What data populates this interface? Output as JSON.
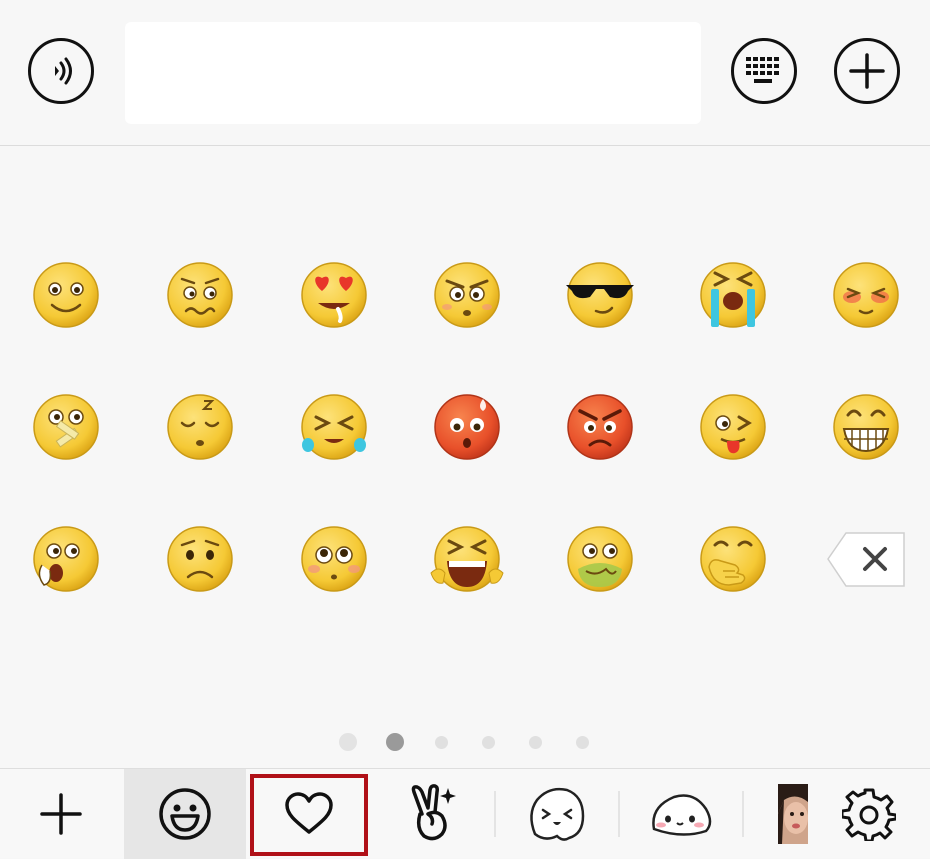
{
  "topbar": {
    "voice_icon": "voice-input-icon",
    "message_input_value": "",
    "keyboard_icon": "keyboard-icon",
    "more_icon": "plus-circle-icon"
  },
  "emoji_panel": {
    "rows": [
      [
        "smile",
        "awkward",
        "heart-eyes",
        "stare",
        "cool",
        "crying-loud",
        "blushing"
      ],
      [
        "shush",
        "sleepy",
        "tears-of-laughter",
        "embarrassed",
        "angry",
        "tongue-wink",
        "grin"
      ],
      [
        "surprised",
        "sad",
        "pleading",
        "scream",
        "nauseous",
        "giggle"
      ]
    ],
    "delete_icon": "backspace-icon",
    "page_count": 6,
    "current_page": 2
  },
  "tabbar": {
    "tabs": [
      {
        "id": "add",
        "icon": "plus-icon"
      },
      {
        "id": "emoji",
        "icon": "smiley-icon",
        "selected": true
      },
      {
        "id": "favorites",
        "icon": "heart-icon",
        "highlighted": true
      },
      {
        "id": "gesture",
        "icon": "victory-hand-icon"
      },
      {
        "id": "sticker-face",
        "icon": "cartoon-face-icon"
      },
      {
        "id": "sticker-bun",
        "icon": "bun-face-icon"
      },
      {
        "id": "custom",
        "icon": "user-photo-sticker"
      },
      {
        "id": "settings",
        "icon": "gear-icon"
      }
    ]
  },
  "colors": {
    "emoji_yellow": "#f5c935",
    "emoji_red": "#e8502a",
    "highlight_red": "#b01118"
  }
}
